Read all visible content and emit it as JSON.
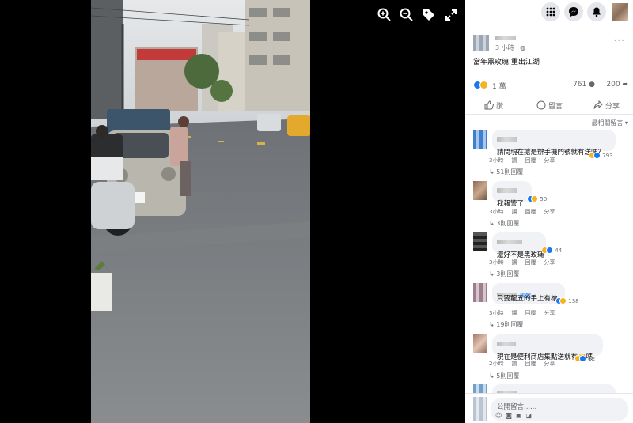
{
  "viewer": {
    "tools": [
      "zoom-in-icon",
      "zoom-out-icon",
      "tag-icon",
      "fullscreen-icon"
    ]
  },
  "header": {
    "icons": [
      "menu-grid-icon",
      "messenger-icon",
      "bell-icon"
    ]
  },
  "post": {
    "time": "3 小時 · ",
    "text": "當年黑玫瑰 重出江湖",
    "reaction_count": "1 萬",
    "comment_count": "761",
    "share_count": "200",
    "like_label": "讚",
    "comment_label": "留言",
    "share_label": "分享",
    "sort_label": "最相關留言"
  },
  "comments": [
    {
      "text": "請問現在搶是辦手機門號就有送嗎？",
      "time": "3小時",
      "like": "讚",
      "reply": "回覆",
      "share": "分享",
      "react_count": "793",
      "replies": "51則回覆",
      "author_badge": ""
    },
    {
      "text": "我報警了",
      "time": "3小時",
      "like": "讚",
      "reply": "回覆",
      "share": "分享",
      "react_count": "50",
      "replies": "3則回覆",
      "author_badge": ""
    },
    {
      "text": "還好不是黑玫瑰",
      "time": "3小時",
      "like": "讚",
      "reply": "回覆",
      "share": "分享",
      "react_count": "44",
      "replies": "3則回覆",
      "author_badge": ""
    },
    {
      "text": "只要龍五的手上有槍",
      "time": "3小時",
      "like": "讚",
      "reply": "回覆",
      "share": "分享",
      "react_count": "138",
      "replies": "19則回覆",
      "author_badge": "編麗"
    },
    {
      "text": "現在是便利商店集點送就有🔫嗎",
      "time": "2小時",
      "like": "讚",
      "reply": "回覆",
      "share": "分享",
      "react_count": "12",
      "replies": "5則回覆",
      "author_badge": ""
    }
  ],
  "reply_box": {
    "placeholder": "公開留言......",
    "icons": [
      "emoji-icon",
      "camera-icon",
      "gif-icon",
      "sticker-icon"
    ]
  }
}
